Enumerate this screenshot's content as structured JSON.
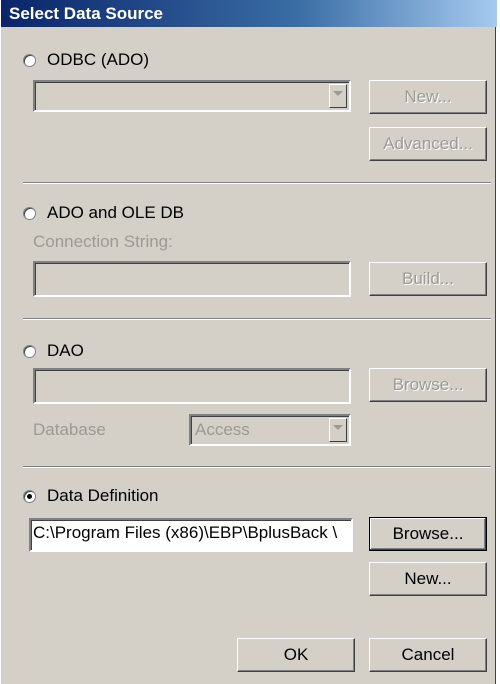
{
  "dialog": {
    "title": "Select Data Source"
  },
  "odbc": {
    "label": "ODBC (ADO)",
    "dropdown_value": "",
    "new_button": "New...",
    "advanced_button": "Advanced..."
  },
  "ado": {
    "label": "ADO and OLE DB",
    "connection_label": "Connection String:",
    "connection_value": "",
    "build_button": "Build..."
  },
  "dao": {
    "label": "DAO",
    "path_value": "",
    "browse_button": "Browse...",
    "database_label": "Database",
    "database_value": "Access"
  },
  "data_definition": {
    "label": "Data Definition",
    "selected": true,
    "path_value": "C:\\Program Files (x86)\\EBP\\BplusBack \\",
    "browse_button": "Browse...",
    "new_button": "New..."
  },
  "footer": {
    "ok_button": "OK",
    "cancel_button": "Cancel"
  },
  "colors": {
    "dialog_bg": "#d4d0c8",
    "title_start": "#0a246a",
    "title_end": "#a6caf0",
    "disabled_text": "#9d9a93"
  }
}
